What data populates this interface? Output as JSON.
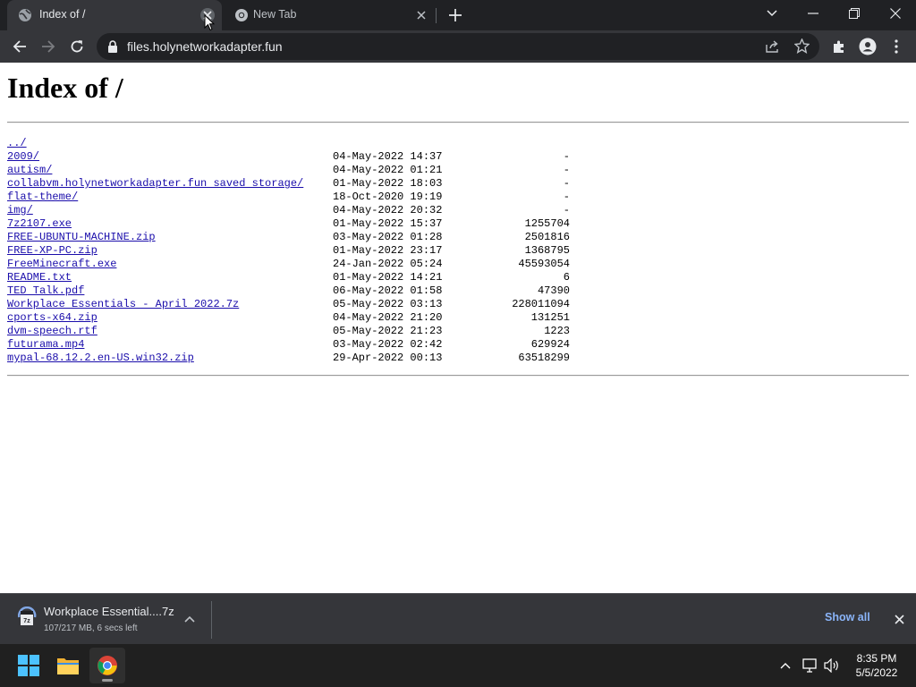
{
  "browser": {
    "tabs": [
      {
        "title": "Index of /",
        "active": true
      },
      {
        "title": "New Tab",
        "active": false
      }
    ],
    "url": "files.holynetworkadapter.fun"
  },
  "page": {
    "heading": "Index of /",
    "entries": [
      {
        "name": "../",
        "date": "",
        "size": ""
      },
      {
        "name": "2009/",
        "date": "04-May-2022 14:37",
        "size": "-"
      },
      {
        "name": "autism/",
        "date": "04-May-2022 01:21",
        "size": "-"
      },
      {
        "name": "collabvm.holynetworkadapter.fun saved storage/",
        "date": "01-May-2022 18:03",
        "size": "-"
      },
      {
        "name": "flat-theme/",
        "date": "18-Oct-2020 19:19",
        "size": "-"
      },
      {
        "name": "img/",
        "date": "04-May-2022 20:32",
        "size": "-"
      },
      {
        "name": "7z2107.exe",
        "date": "01-May-2022 15:37",
        "size": "1255704"
      },
      {
        "name": "FREE-UBUNTU-MACHINE.zip",
        "date": "03-May-2022 01:28",
        "size": "2501816"
      },
      {
        "name": "FREE-XP-PC.zip",
        "date": "01-May-2022 23:17",
        "size": "1368795"
      },
      {
        "name": "FreeMinecraft.exe",
        "date": "24-Jan-2022 05:24",
        "size": "45593054"
      },
      {
        "name": "README.txt",
        "date": "01-May-2022 14:21",
        "size": "6"
      },
      {
        "name": "TED Talk.pdf",
        "date": "06-May-2022 01:58",
        "size": "47390"
      },
      {
        "name": "Workplace Essentials - April 2022.7z",
        "date": "05-May-2022 03:13",
        "size": "228011094"
      },
      {
        "name": "cports-x64.zip",
        "date": "04-May-2022 21:20",
        "size": "131251"
      },
      {
        "name": "dvm-speech.rtf",
        "date": "05-May-2022 21:23",
        "size": "1223"
      },
      {
        "name": "futurama.mp4",
        "date": "03-May-2022 02:42",
        "size": "629924"
      },
      {
        "name": "mypal-68.12.2.en-US.win32.zip",
        "date": "29-Apr-2022 00:13",
        "size": "63518299"
      }
    ]
  },
  "download_shelf": {
    "file_name": "Workplace Essential....7z",
    "status": "107/217 MB, 6 secs left",
    "progress": 0.49,
    "show_all_label": "Show all"
  },
  "taskbar": {
    "apps": [
      "start-icon",
      "file-explorer-icon",
      "chrome-icon"
    ],
    "time": "8:35 PM",
    "date": "5/5/2022"
  },
  "colors": {
    "tabstrip": "#202124",
    "toolbar": "#35363a",
    "link": "#1a0dab",
    "show_all": "#8ab4f8",
    "taskbar": "#202020"
  }
}
